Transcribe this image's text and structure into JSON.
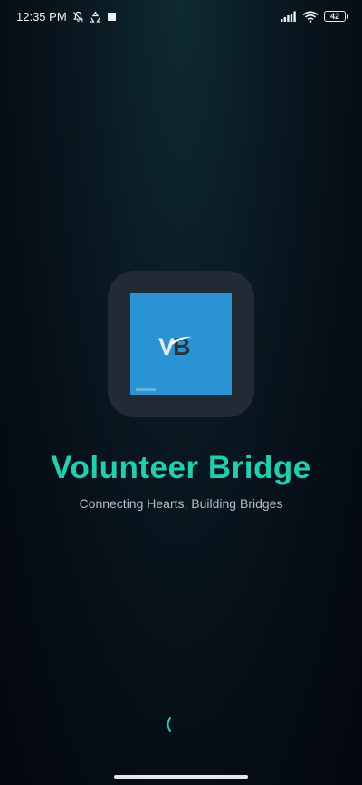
{
  "status_bar": {
    "time": "12:35 PM",
    "battery": "42",
    "icons": [
      "muted-bell-icon",
      "recycle-icon",
      "stop-square-icon",
      "signal-icon",
      "wifi-icon",
      "battery-icon"
    ]
  },
  "app": {
    "name": "Volunteer Bridge",
    "tagline": "Connecting Hearts, Building Bridges",
    "logo_text_v": "V",
    "logo_text_b": "B"
  },
  "colors": {
    "title": "#22cdb0",
    "logo_tile": "#2a93d3",
    "logo_frame": "#222a36",
    "background": "#060d16"
  }
}
